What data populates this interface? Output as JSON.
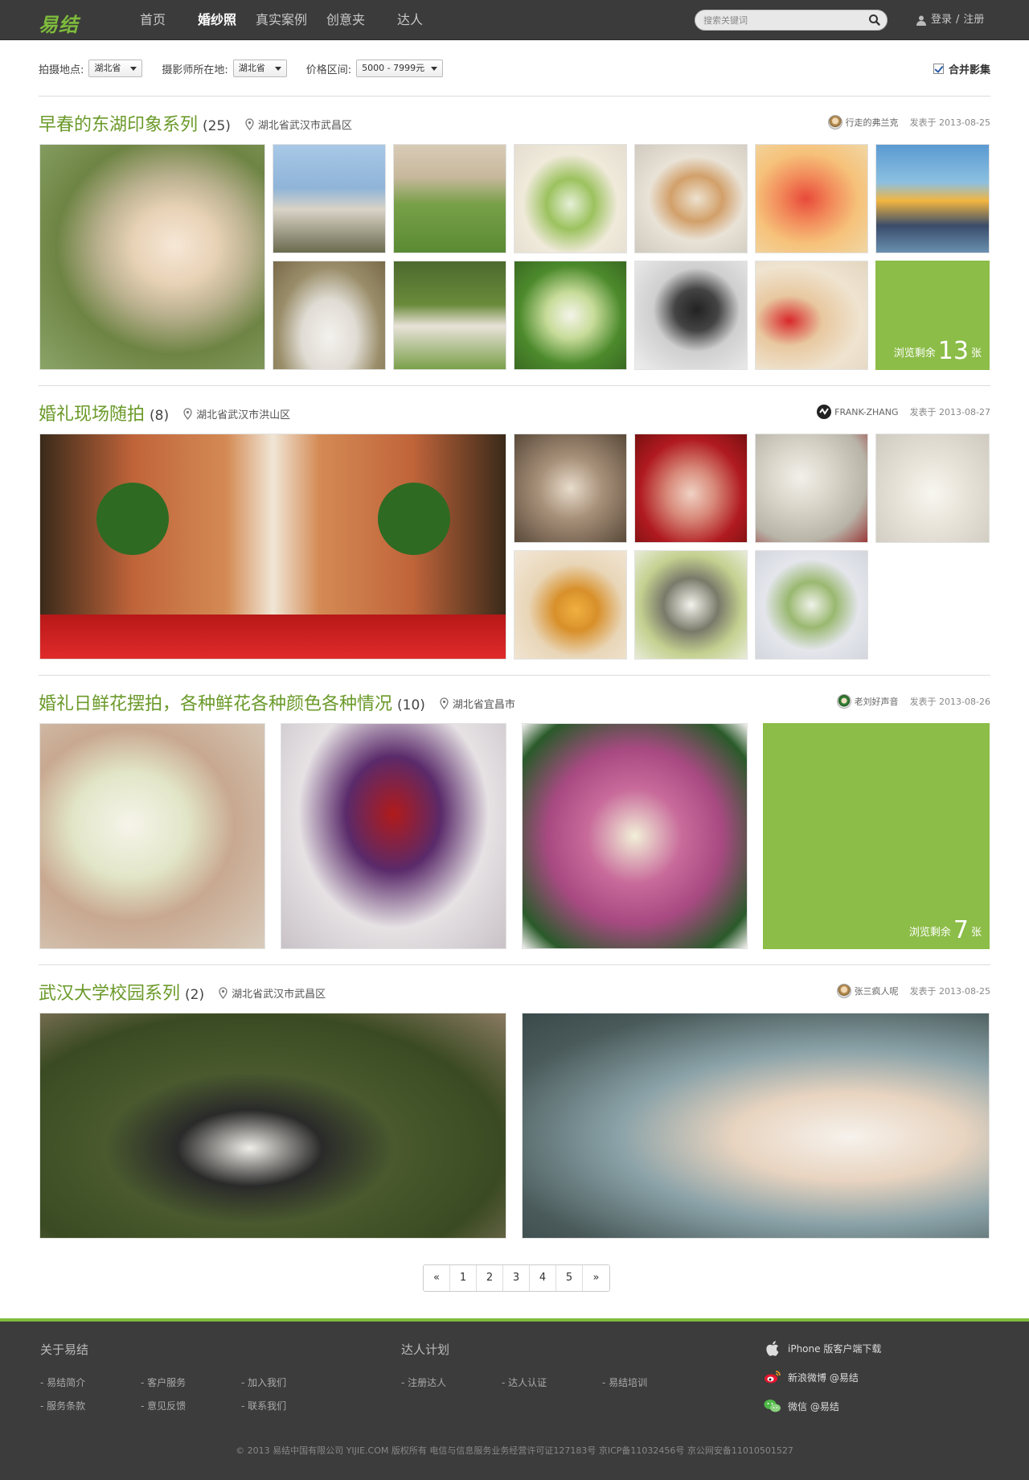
{
  "header": {
    "logo": "易结",
    "nav": [
      "首页",
      "婚纱照",
      "真实案例",
      "创意夹",
      "达人"
    ],
    "search_placeholder": "搜索关键词",
    "login": "登录",
    "sep": "/",
    "register": "注册"
  },
  "filters": {
    "location_label": "拍摄地点:",
    "location_value": "湖北省",
    "photographer_label": "摄影师所在地:",
    "photographer_value": "湖北省",
    "price_label": "价格区间:",
    "price_value": "5000 - 7999元",
    "merge_label": "合并影集"
  },
  "albums": [
    {
      "title": "早春的东湖印象系列",
      "count": "(25)",
      "location": "湖北省武汉市武昌区",
      "author": "行走的弗兰克",
      "date": "发表于 2013-08-25",
      "more_prefix": "浏览剩余",
      "more_count": "13",
      "more_suffix": "张"
    },
    {
      "title": "婚礼现场随拍",
      "count": "(8)",
      "location": "湖北省武汉市洪山区",
      "author": "FRANK-ZHANG",
      "date": "发表于 2013-08-27"
    },
    {
      "title": "婚礼日鲜花摆拍，各种鲜花各种颜色各种情况",
      "count": "(10)",
      "location": "湖北省宜昌市",
      "author": "老刘好声音",
      "date": "发表于 2013-08-26",
      "more_prefix": "浏览剩余",
      "more_count": "7",
      "more_suffix": "张"
    },
    {
      "title": "武汉大学校园系列",
      "count": "(2)",
      "location": "湖北省武汉市武昌区",
      "author": "张三疯人呢",
      "date": "发表于 2013-08-25"
    }
  ],
  "pagination": [
    "«",
    "1",
    "2",
    "3",
    "4",
    "5",
    "»"
  ],
  "footer": {
    "about_title": "关于易结",
    "about_links": [
      "- 易结简介",
      "- 客户服务",
      "- 加入我们",
      "- 服务条款",
      "- 意见反馈",
      "- 联系我们"
    ],
    "expert_title": "达人计划",
    "expert_links": [
      "- 注册达人",
      "- 达人认证",
      "- 易结培训"
    ],
    "apps": [
      "iPhone 版客户端下载",
      "新浪微博 @易结",
      "微信 @易结"
    ],
    "copyright": "© 2013  易结中国有限公司 YIJIE.COM  版权所有    电信与信息服务业务经营许可证127183号    京ICP备11032456号    京公网安备11010501527"
  },
  "colors": {
    "brand_green": "#7ebc3c",
    "title_green": "#6b9a2a",
    "more_tile": "#8cbd48",
    "header_bg": "#3b3b3b",
    "footer_bg": "#3c3c3c"
  }
}
